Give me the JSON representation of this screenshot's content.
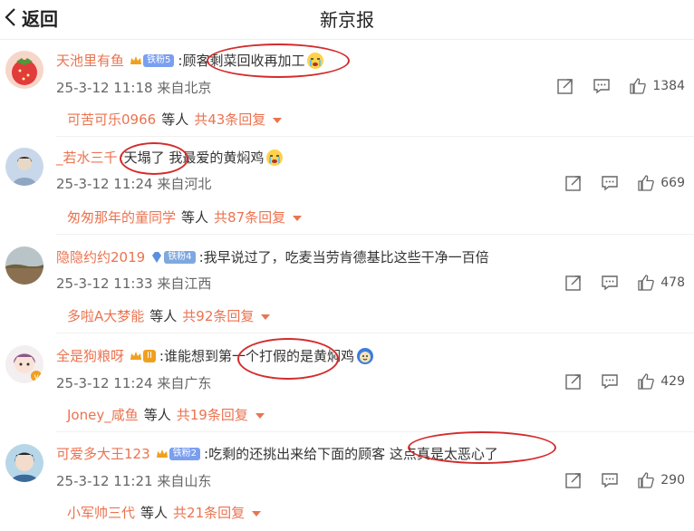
{
  "header": {
    "back_label": "返回",
    "title": "新京报"
  },
  "comments": [
    {
      "user": "天池里有鱼",
      "badge": "铁粉5",
      "badge_color": "#7a9ff0",
      "text": ":顾客剩菜回收再加工",
      "emoji": "crying",
      "date": "25-3-12 11:18",
      "location": "来自北京",
      "likes": "1384",
      "replier": "可苦可乐0966",
      "replier_suffix": "等人",
      "reply_count": "共43条回复"
    },
    {
      "user": "_若水三千",
      "badge": "",
      "badge_color": "",
      "text": ":天塌了 我最爱的黄焖鸡",
      "emoji": "crying",
      "date": "25-3-12 11:24",
      "location": "来自河北",
      "likes": "669",
      "replier": "匆匆那年的童同学",
      "replier_suffix": "等人",
      "reply_count": "共87条回复"
    },
    {
      "user": "隐隐约约2019",
      "badge": "铁粉4",
      "badge_color": "#7fa8e0",
      "text": ":我早说过了，吃麦当劳肯德基比这些干净一百倍",
      "emoji": "",
      "date": "25-3-12 11:33",
      "location": "来自江西",
      "likes": "478",
      "replier": "多啦A大梦能",
      "replier_suffix": "等人",
      "reply_count": "共92条回复"
    },
    {
      "user": "全是狗粮呀",
      "badge": "II",
      "badge_color": "#f0a020",
      "text": ":谁能想到第一个打假的是黄焖鸡",
      "emoji": "doge",
      "date": "25-3-12 11:24",
      "location": "来自广东",
      "likes": "429",
      "replier": "Joney_咸鱼",
      "replier_suffix": "等人",
      "reply_count": "共19条回复"
    },
    {
      "user": "可爱多大王123",
      "badge": "铁粉2",
      "badge_color": "#7a9ff0",
      "text": ":吃剩的还挑出来给下面的顾客 这点真是太恶心了",
      "emoji": "",
      "date": "25-3-12 11:21",
      "location": "来自山东",
      "likes": "290",
      "replier": "小军帅三代",
      "replier_suffix": "等人",
      "reply_count": "共21条回复"
    }
  ]
}
